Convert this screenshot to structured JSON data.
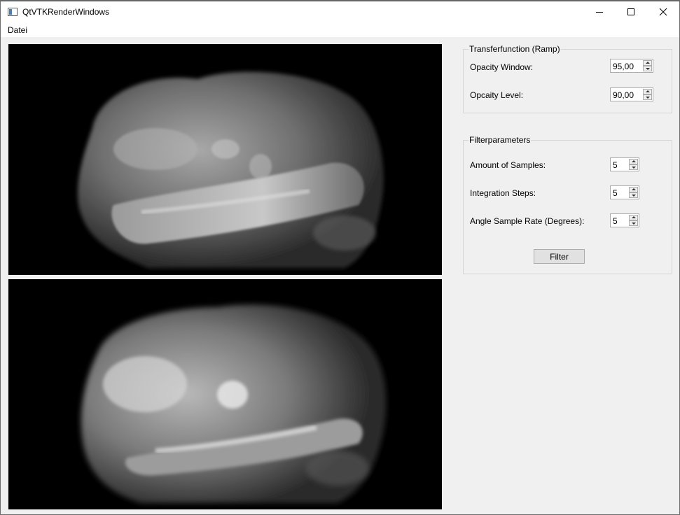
{
  "window": {
    "title": "QtVTKRenderWindows"
  },
  "menu": {
    "items": [
      "Datei"
    ]
  },
  "transfer_group": {
    "title": "Transferfunction (Ramp)",
    "opacity_window": {
      "label": "Opacity Window:",
      "value": "95,00"
    },
    "opacity_level": {
      "label": "Opcaity Level:",
      "value": "90,00"
    }
  },
  "filter_group": {
    "title": "Filterparameters",
    "amount_samples": {
      "label": "Amount of Samples:",
      "value": "5"
    },
    "integration_steps": {
      "label": "Integration Steps:",
      "value": "5"
    },
    "angle_sample_rate": {
      "label": "Angle Sample Rate (Degrees):",
      "value": "5"
    },
    "filter_button": "Filter"
  },
  "icons": {
    "minimize": "minimize-icon",
    "maximize": "maximize-icon",
    "close": "close-icon",
    "app": "app-icon"
  },
  "colors": {
    "render_background": "#000000",
    "panel_background": "#f0f0f0",
    "group_border": "#d5d5d5",
    "button_background": "#e1e1e1"
  }
}
